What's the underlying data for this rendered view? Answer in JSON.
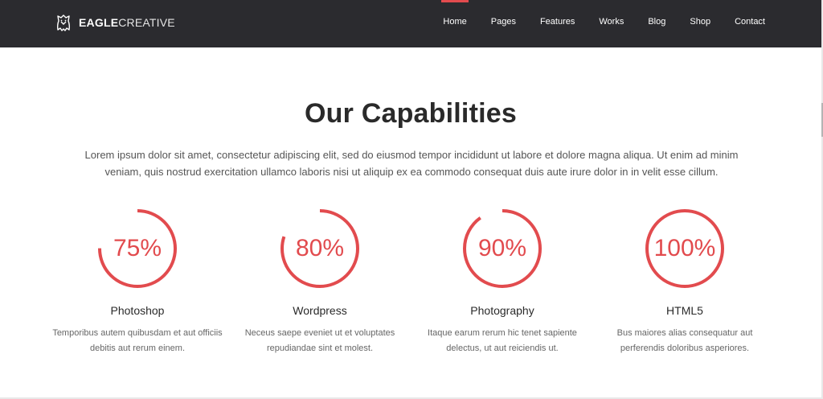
{
  "brand": {
    "bold": "EAGLE",
    "light": "CREATIVE"
  },
  "nav": [
    {
      "label": "Home",
      "active": true
    },
    {
      "label": "Pages",
      "active": false
    },
    {
      "label": "Features",
      "active": false
    },
    {
      "label": "Works",
      "active": false
    },
    {
      "label": "Blog",
      "active": false
    },
    {
      "label": "Shop",
      "active": false
    },
    {
      "label": "Contact",
      "active": false
    }
  ],
  "section": {
    "title": "Our Capabilities",
    "intro": "Lorem ipsum dolor sit amet, consectetur adipiscing elit, sed do eiusmod tempor incididunt ut labore et dolore magna aliqua. Ut enim ad minim veniam, quis nostrud exercitation ullamco laboris nisi ut aliquip ex ea commodo consequat duis aute irure dolor in in velit esse cillum."
  },
  "capabilities": [
    {
      "percent": 75,
      "label": "75%",
      "name": "Photoshop",
      "desc": "Temporibus autem quibusdam et aut officiis debitis aut rerum einem."
    },
    {
      "percent": 80,
      "label": "80%",
      "name": "Wordpress",
      "desc": "Neceus saepe eveniet ut et voluptates repudiandae sint et molest."
    },
    {
      "percent": 90,
      "label": "90%",
      "name": "Photography",
      "desc": "Itaque earum rerum hic tenet sapiente delectus, ut aut reiciendis ut."
    },
    {
      "percent": 100,
      "label": "100%",
      "name": "HTML5",
      "desc": "Bus maiores alias consequatur aut perferendis doloribus asperiores."
    }
  ],
  "colors": {
    "accent": "#e24b4e",
    "topbar": "#2b2b2f"
  }
}
